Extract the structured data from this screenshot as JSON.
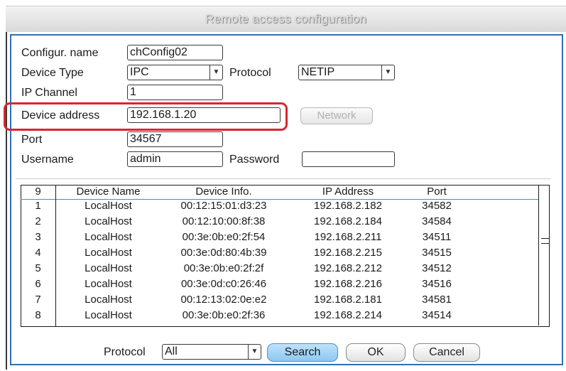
{
  "window": {
    "title": "Remote access configuration"
  },
  "form": {
    "config_name": {
      "label": "Configur. name",
      "value": "chConfig02"
    },
    "device_type": {
      "label": "Device Type",
      "value": "IPC"
    },
    "protocol": {
      "label": "Protocol",
      "value": "NETIP"
    },
    "ip_channel": {
      "label": "IP Channel",
      "value": "1"
    },
    "device_address": {
      "label": "Device address",
      "value": "192.168.1.20"
    },
    "network_button": "Network",
    "port": {
      "label": "Port",
      "value": "34567"
    },
    "username": {
      "label": "Username",
      "value": "admin"
    },
    "password": {
      "label": "Password",
      "value": ""
    }
  },
  "device_list": {
    "count": "9",
    "columns": [
      "Device Name",
      "Device Info.",
      "IP Address",
      "Port"
    ],
    "rows": [
      {
        "no": "1",
        "name": "LocalHost",
        "info": "00:12:15:01:d3:23",
        "ip": "192.168.2.182",
        "port": "34582"
      },
      {
        "no": "2",
        "name": "LocalHost",
        "info": "00:12:10:00:8f:38",
        "ip": "192.168.2.184",
        "port": "34584"
      },
      {
        "no": "3",
        "name": "LocalHost",
        "info": "00:3e:0b:e0:2f:54",
        "ip": "192.168.2.211",
        "port": "34511"
      },
      {
        "no": "4",
        "name": "LocalHost",
        "info": "00:3e:0d:80:4b:39",
        "ip": "192.168.2.215",
        "port": "34515"
      },
      {
        "no": "5",
        "name": "LocalHost",
        "info": "00:3e:0b:e0:2f:2f",
        "ip": "192.168.2.212",
        "port": "34512"
      },
      {
        "no": "6",
        "name": "LocalHost",
        "info": "00:3e:0d:c0:26:46",
        "ip": "192.168.2.216",
        "port": "34516"
      },
      {
        "no": "7",
        "name": "LocalHost",
        "info": "00:12:13:02:0e:e2",
        "ip": "192.168.2.181",
        "port": "34581"
      },
      {
        "no": "8",
        "name": "LocalHost",
        "info": "00:3e:0b:e0:2f:36",
        "ip": "192.168.2.214",
        "port": "34514"
      }
    ]
  },
  "footer": {
    "protocol_label": "Protocol",
    "protocol_value": "All",
    "search": "Search",
    "ok": "OK",
    "cancel": "Cancel"
  },
  "colors": {
    "highlight": "#d9272e",
    "frame": "#2e6fb8",
    "search_button": "#8cc8f3"
  }
}
